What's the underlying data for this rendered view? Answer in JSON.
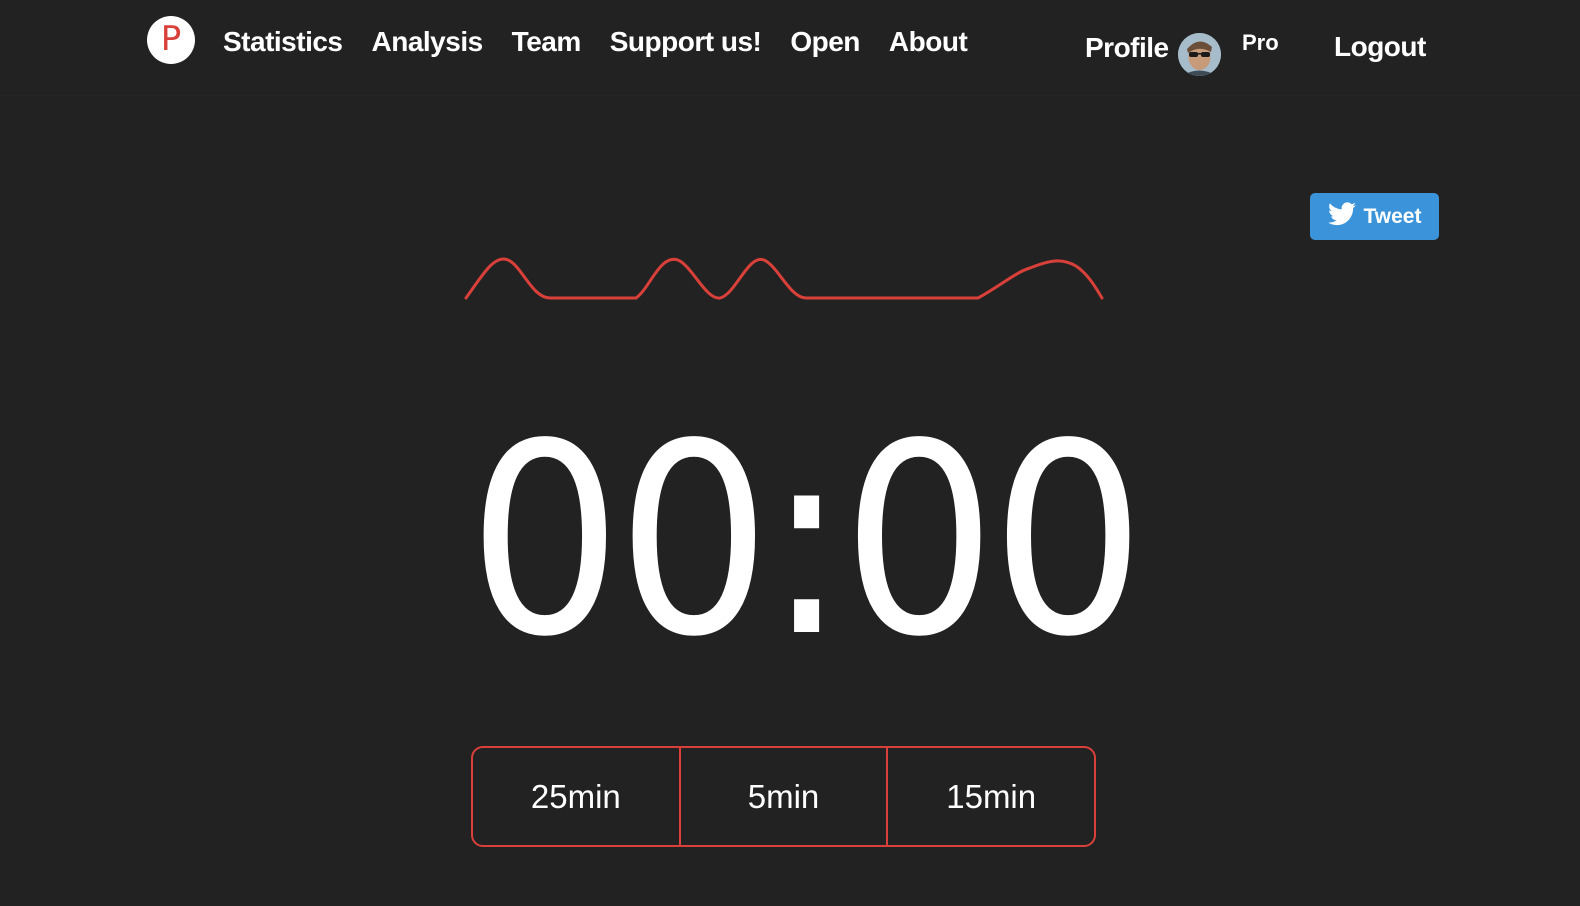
{
  "brand": {
    "logo_letter": "P",
    "logo_color": "#d9403a"
  },
  "nav": {
    "items": [
      {
        "label": "Statistics"
      },
      {
        "label": "Analysis"
      },
      {
        "label": "Team"
      },
      {
        "label": "Support us!"
      },
      {
        "label": "Open"
      },
      {
        "label": "About"
      }
    ],
    "profile_label": "Profile",
    "plan_badge": "Pro",
    "logout_label": "Logout"
  },
  "share": {
    "tweet_label": "Tweet",
    "tweet_color": "#3b94d9",
    "icon": "twitter-bird-icon"
  },
  "timer": {
    "display": "00:00"
  },
  "durations": [
    {
      "label": "25min"
    },
    {
      "label": "5min"
    },
    {
      "label": "15min"
    }
  ],
  "theme": {
    "background": "#222222",
    "accent": "#d9403a",
    "text": "#ffffff"
  }
}
